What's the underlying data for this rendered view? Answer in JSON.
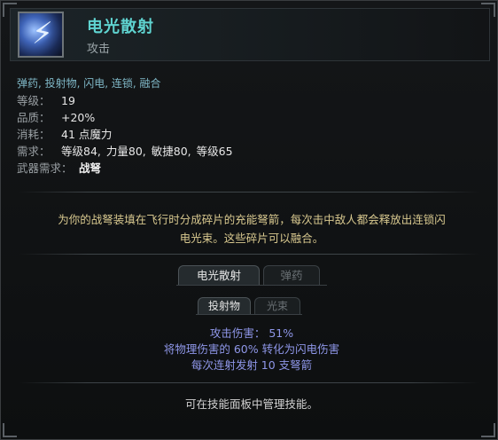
{
  "skill": {
    "name": "电光散射",
    "type": "攻击",
    "icon": "lightning-crossbow-icon"
  },
  "tags": "弹药, 投射物, 闪电, 连锁, 融合",
  "stats": {
    "level_label": "等级：",
    "level_value": "19",
    "quality_label": "品质：",
    "quality_value": "+20%",
    "cost_label": "消耗：",
    "cost_value": "41 点魔力",
    "req_label": "需求：",
    "requirements": [
      "等级84,",
      "力量80,",
      "敏捷80,",
      "等级65"
    ],
    "weapon_label": "武器需求：",
    "weapon_value": "战弩"
  },
  "description": [
    "为你的战弩装填在飞行时分成碎片的充能弩箭，每次击中敌人都会释放出连锁闪",
    "电光束。这些碎片可以融合。"
  ],
  "tabs_primary": [
    {
      "label": "电光散射",
      "active": true
    },
    {
      "label": "弹药",
      "active": false
    }
  ],
  "tabs_secondary": [
    {
      "label": "投射物",
      "active": true
    },
    {
      "label": "光束",
      "active": false
    }
  ],
  "details": [
    "攻击伤害：  51%",
    "将物理伤害的 60% 转化为闪电伤害",
    "每次连射发射 10 支弩箭"
  ],
  "footer": "可在技能面板中管理技能。",
  "colors": {
    "title": "#5fd3d0",
    "tags": "#7fb7c6",
    "description": "#d8c88f",
    "details": "#8e96e8"
  }
}
